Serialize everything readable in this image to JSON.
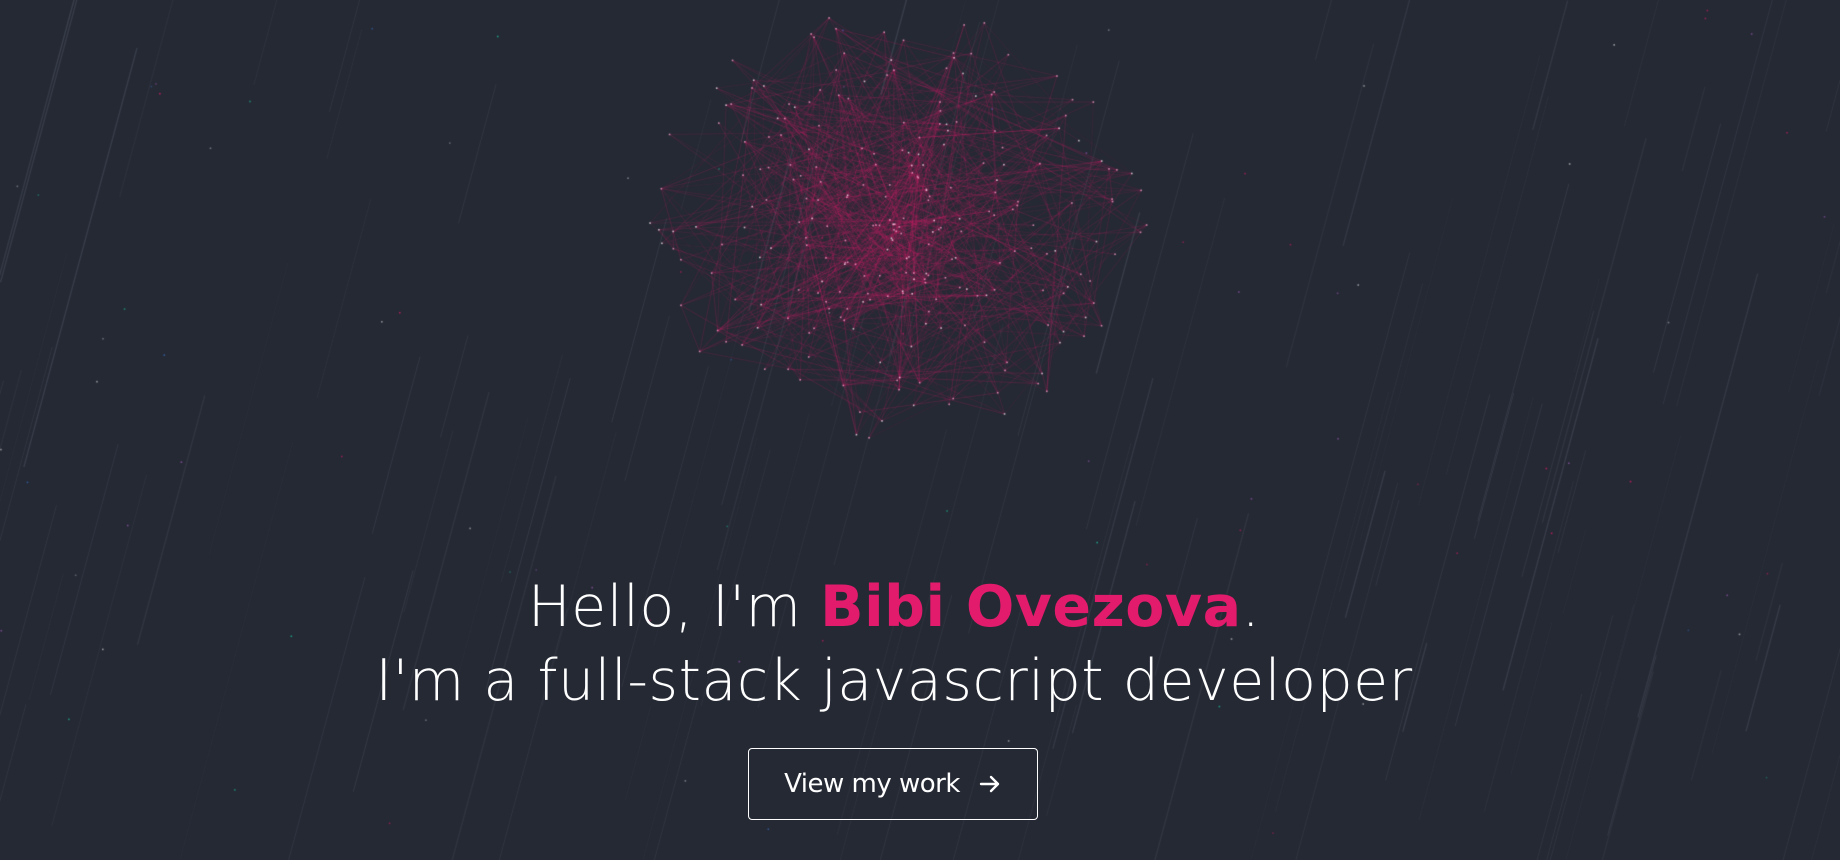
{
  "hero": {
    "greeting_prefix": "Hello, I'm ",
    "name": "Bibi Ovezova",
    "greeting_suffix": ".",
    "tagline": "I'm a full-stack javascript developer"
  },
  "cta": {
    "label": "View my work",
    "icon": "arrow-right-icon"
  },
  "colors": {
    "background": "#252934",
    "accent": "#e31b6d",
    "text": "#ffffff"
  }
}
